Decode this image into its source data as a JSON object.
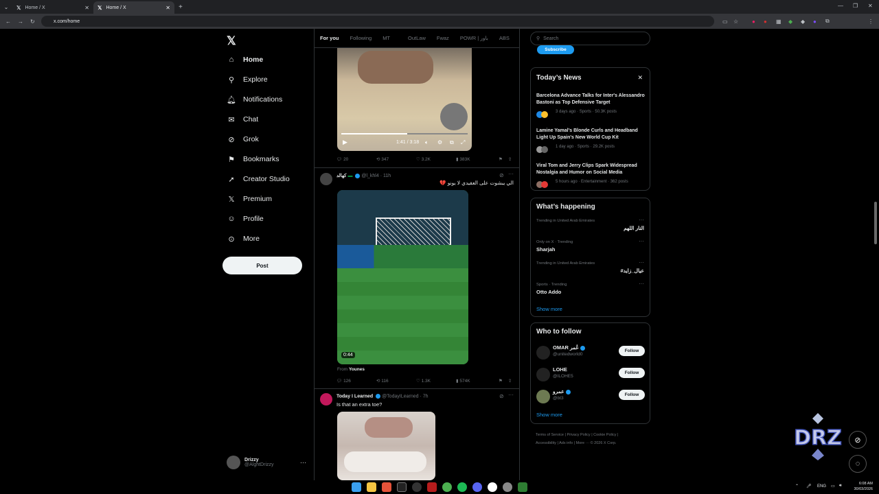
{
  "browser": {
    "tabs": [
      {
        "title": "Home / X",
        "active": false
      },
      {
        "title": "Home / X",
        "active": true
      }
    ],
    "url": "x.com/home"
  },
  "nav": {
    "items": [
      {
        "label": "Home",
        "icon": "home-icon"
      },
      {
        "label": "Explore",
        "icon": "search-icon"
      },
      {
        "label": "Notifications",
        "icon": "bell-icon"
      },
      {
        "label": "Chat",
        "icon": "mail-icon"
      },
      {
        "label": "Grok",
        "icon": "grok-icon"
      },
      {
        "label": "Bookmarks",
        "icon": "bookmark-icon"
      },
      {
        "label": "Creator Studio",
        "icon": "rocket-icon"
      },
      {
        "label": "Premium",
        "icon": "x-icon"
      },
      {
        "label": "Profile",
        "icon": "person-icon"
      },
      {
        "label": "More",
        "icon": "more-circle-icon"
      }
    ],
    "post_label": "Post",
    "account": {
      "name": "Drizzy",
      "handle": "@AlghtDrizzy"
    }
  },
  "feed": {
    "tabs": [
      "For you",
      "Following",
      "MT",
      "OutLaw",
      "Fwaz",
      "POWR | باور",
      "ABS"
    ],
    "tweet1": {
      "video_time": "1:41 / 3:18",
      "replies": "20",
      "reposts": "347",
      "likes": "3.2K",
      "views": "383K"
    },
    "tweet2": {
      "name": "كهالد",
      "handle": "@l_khl4",
      "time": "11h",
      "text": "الي يبشوت على العقيدي لا يونو 💔",
      "video_badge": "0:44",
      "from_label": "From",
      "from_name": "Younes",
      "replies": "126",
      "reposts": "116",
      "likes": "1.3K",
      "views": "574K"
    },
    "tweet3": {
      "name": "Today I Learned",
      "handle": "@TodayILearned",
      "time": "7h",
      "text": "Is that an extra toe?"
    }
  },
  "right": {
    "search_placeholder": "Search",
    "subscribe_label": "Subscribe",
    "news": {
      "title": "Today’s News",
      "items": [
        {
          "title": "Barcelona Advance Talks for Inter's Alessandro Bastoni as Top Defensive Target",
          "meta": "3 days ago · Sports · 50.3K posts"
        },
        {
          "title": "Lamine Yamal's Blonde Curls and Headband Light Up Spain's New World Cup Kit",
          "meta": "1 day ago · Sports · 29.2K posts"
        },
        {
          "title": "Viral Tom and Jerry Clips Spark Widespread Nostalgia and Humor on Social Media",
          "meta": "5 hours ago · Entertainment · 362 posts"
        }
      ]
    },
    "happening": {
      "title": "What’s happening",
      "items": [
        {
          "meta": "Trending in United Arab Emirates",
          "name": "النار اللهم",
          "rtl": true
        },
        {
          "meta": "Only on X · Trending",
          "name": "Sharjah",
          "rtl": false
        },
        {
          "meta": "Trending in United Arab Emirates",
          "name": "#عيال_زايد",
          "rtl": true
        },
        {
          "meta": "Sports · Trending",
          "name": "Otto Addo",
          "rtl": false
        }
      ],
      "show_more": "Show more"
    },
    "who_to_follow": {
      "title": "Who to follow",
      "items": [
        {
          "name": "OMAR عُمر",
          "handle": "@unitedworld0",
          "btn": "Follow"
        },
        {
          "name": "LOHE",
          "handle": "@ILOHE5",
          "btn": "Follow"
        },
        {
          "name": "عمرو",
          "handle": "@bt3",
          "btn": "Follow"
        }
      ],
      "show_more": "Show more"
    },
    "footer": {
      "line1": "Terms of Service  |  Privacy Policy  |  Cookie Policy  |",
      "line2": "Accessibility  |  Ads info  |  More ···  © 2026 X Corp."
    }
  },
  "taskbar": {
    "lang": "ENG",
    "time": "6:08 AM",
    "date": "30/03/2026"
  },
  "overlay": {
    "logo_text": "DRZ"
  }
}
